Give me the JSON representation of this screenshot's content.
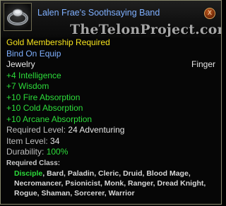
{
  "item": {
    "name": "Lalen Frae's Soothsaying Band",
    "icon": "ring-icon",
    "watermark": "TheTelonProject.com"
  },
  "requirements": {
    "membership": "Gold Membership Required",
    "bind": "Bind On Equip"
  },
  "type": {
    "category": "Jewelry",
    "slot": "Finger"
  },
  "stats": [
    "+4 Intelligence",
    "+7 Wisdom",
    "+10 Fire Absorption",
    "+10 Cold Absorption",
    "+10 Arcane Absorption"
  ],
  "required_level": {
    "label": "Required Level:",
    "value": "24 Adventuring"
  },
  "item_level": {
    "label": "Item Level:",
    "value": "34"
  },
  "durability": {
    "label": "Durability:",
    "value": "100%"
  },
  "required_class": {
    "label": "Required Class:",
    "first": "Disciple",
    "rest": ", Bard, Paladin, Cleric, Druid, Blood Mage, Necromancer, Psionicist, Monk, Ranger, Dread Knight, Rogue, Shaman, Sorcerer, Warrior"
  },
  "close_label": "X"
}
